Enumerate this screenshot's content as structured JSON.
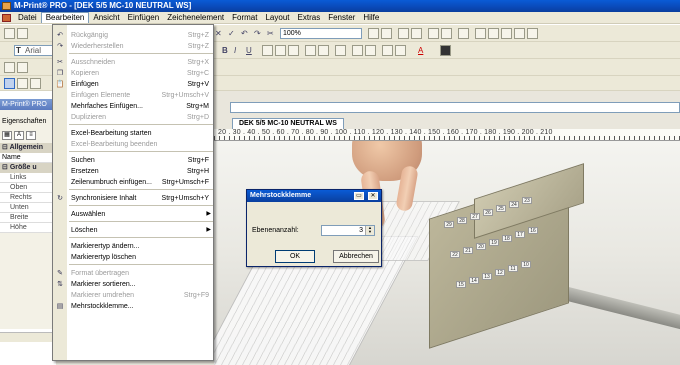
{
  "app": {
    "title": "M-Print® PRO - [DEK 5/5 MC-10 NEUTRAL WS]"
  },
  "menubar": {
    "items": [
      "Datei",
      "Bearbeiten",
      "Ansicht",
      "Einfügen",
      "Zeichenelement",
      "Format",
      "Layout",
      "Extras",
      "Fenster",
      "Hilfe"
    ],
    "active_index": 1
  },
  "toolbar": {
    "zoom": "100%",
    "font": "Arial"
  },
  "left_panel": {
    "title": "M-Print® PRO",
    "label": "Eigenschaften",
    "group1": "Allgemein",
    "name_label": "Name",
    "group2": "Größe u",
    "rows": [
      "Links",
      "Oben",
      "Rechts",
      "Unten",
      "Breite",
      "Höhe"
    ]
  },
  "document": {
    "tab_label": "DEK 5/5 MC-10 NEUTRAL WS",
    "ruler_numbers": "20 . 30 . 40 . 50 . 60 . 70 . 80 . 90 . 100 . 110 . 120 . 130 . 140 . 150 . 160 . 170 . 180 . 190 . 200 . 210"
  },
  "photo": {
    "terminal_labels": [
      "29",
      "28",
      "27",
      "26",
      "25",
      "24",
      "23",
      "22",
      "21",
      "20",
      "19",
      "18",
      "17",
      "16",
      "15",
      "14",
      "13",
      "12",
      "11",
      "10"
    ]
  },
  "dialog": {
    "title": "Mehrstockklemme",
    "label": "Ebenenanzahl:",
    "value": "3",
    "ok": "OK",
    "cancel": "Abbrechen"
  },
  "edit_menu": {
    "items": [
      {
        "label": "Rückgängig",
        "shortcut": "Strg+Z",
        "disabled": true,
        "icon": "undo-icon"
      },
      {
        "label": "Wiederherstellen",
        "shortcut": "Strg+Z",
        "disabled": true,
        "icon": "redo-icon"
      },
      {
        "sep": true
      },
      {
        "label": "Ausschneiden",
        "shortcut": "Strg+X",
        "disabled": true,
        "icon": "cut-icon"
      },
      {
        "label": "Kopieren",
        "shortcut": "Strg+C",
        "disabled": true,
        "icon": "copy-icon"
      },
      {
        "label": "Einfügen",
        "shortcut": "Strg+V",
        "disabled": false,
        "icon": "paste-icon"
      },
      {
        "label": "Einfügen Elemente",
        "shortcut": "Strg+Umsch+V",
        "disabled": true
      },
      {
        "label": "Mehrfaches Einfügen...",
        "shortcut": "Strg+M",
        "disabled": false
      },
      {
        "label": "Duplizieren",
        "shortcut": "Strg+D",
        "disabled": true
      },
      {
        "sep": true
      },
      {
        "label": "Excel-Bearbeitung starten",
        "shortcut": "",
        "disabled": false
      },
      {
        "label": "Excel-Bearbeitung beenden",
        "shortcut": "",
        "disabled": true
      },
      {
        "sep": true
      },
      {
        "label": "Suchen",
        "shortcut": "Strg+F",
        "disabled": false
      },
      {
        "label": "Ersetzen",
        "shortcut": "Strg+H",
        "disabled": false
      },
      {
        "label": "Zeilenumbruch einfügen...",
        "shortcut": "Strg+Umsch+F",
        "disabled": false
      },
      {
        "sep": true
      },
      {
        "label": "Synchronisiere Inhalt",
        "shortcut": "Strg+Umsch+Y",
        "disabled": false,
        "icon": "sync-icon"
      },
      {
        "sep": true
      },
      {
        "label": "Auswählen",
        "shortcut": "",
        "disabled": false,
        "submenu": true
      },
      {
        "sep": true
      },
      {
        "label": "Löschen",
        "shortcut": "",
        "disabled": false,
        "submenu": true
      },
      {
        "sep": true
      },
      {
        "label": "Markierertyp ändern...",
        "shortcut": "",
        "disabled": false
      },
      {
        "label": "Markierertyp löschen",
        "shortcut": "",
        "disabled": false
      },
      {
        "sep": true
      },
      {
        "label": "Format übertragen",
        "shortcut": "",
        "disabled": true,
        "icon": "format-painter-icon"
      },
      {
        "label": "Markierer sortieren...",
        "shortcut": "",
        "disabled": false,
        "icon": "sort-icon"
      },
      {
        "label": "Markierer umdrehen",
        "shortcut": "Strg+F9",
        "disabled": true
      },
      {
        "label": "Mehrstockklemme...",
        "shortcut": "",
        "disabled": false,
        "icon": "terminal-icon"
      }
    ]
  }
}
